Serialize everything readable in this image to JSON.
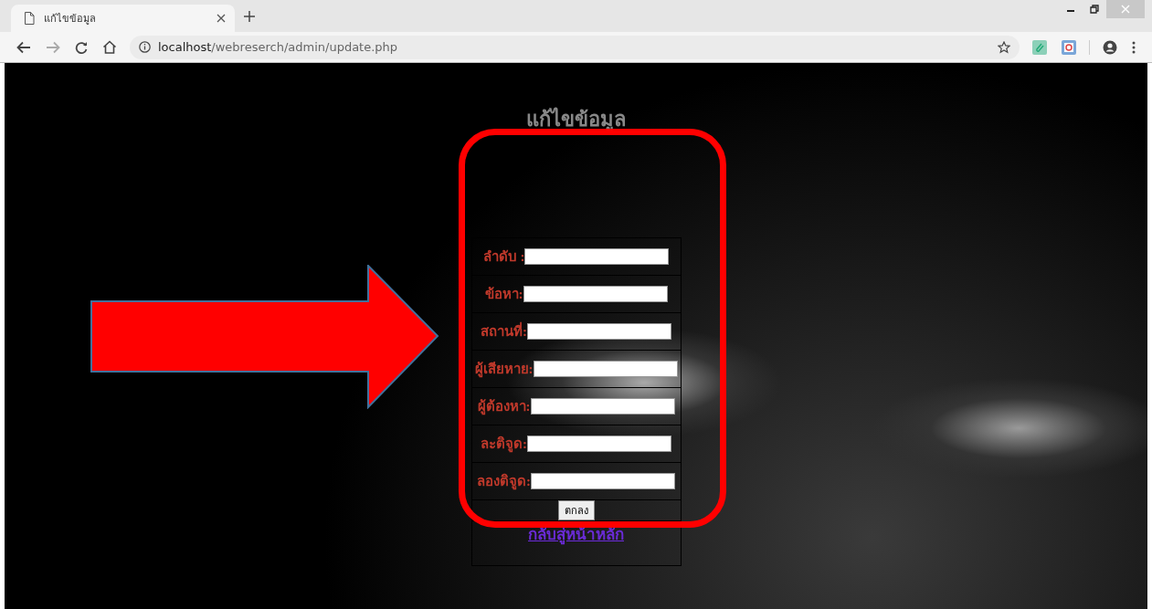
{
  "browser": {
    "tab": {
      "title": "แก้ไขข้อมูล",
      "selected": true
    },
    "address": {
      "host": "localhost",
      "path": "/webreserch/admin/update.php"
    }
  },
  "page": {
    "heading": "แก้ไขข้อมูล",
    "fields": [
      {
        "label": "ลำดับ :"
      },
      {
        "label": "ข้อหา:"
      },
      {
        "label": "สถานที่:"
      },
      {
        "label": "ผู้เสียหาย:"
      },
      {
        "label": "ผู้ต้องหา:"
      },
      {
        "label": "ละติจูด:"
      },
      {
        "label": "ลองติจูด:"
      }
    ],
    "submit": "ตกลง",
    "link": "กลับสู่หน้าหลัก"
  }
}
